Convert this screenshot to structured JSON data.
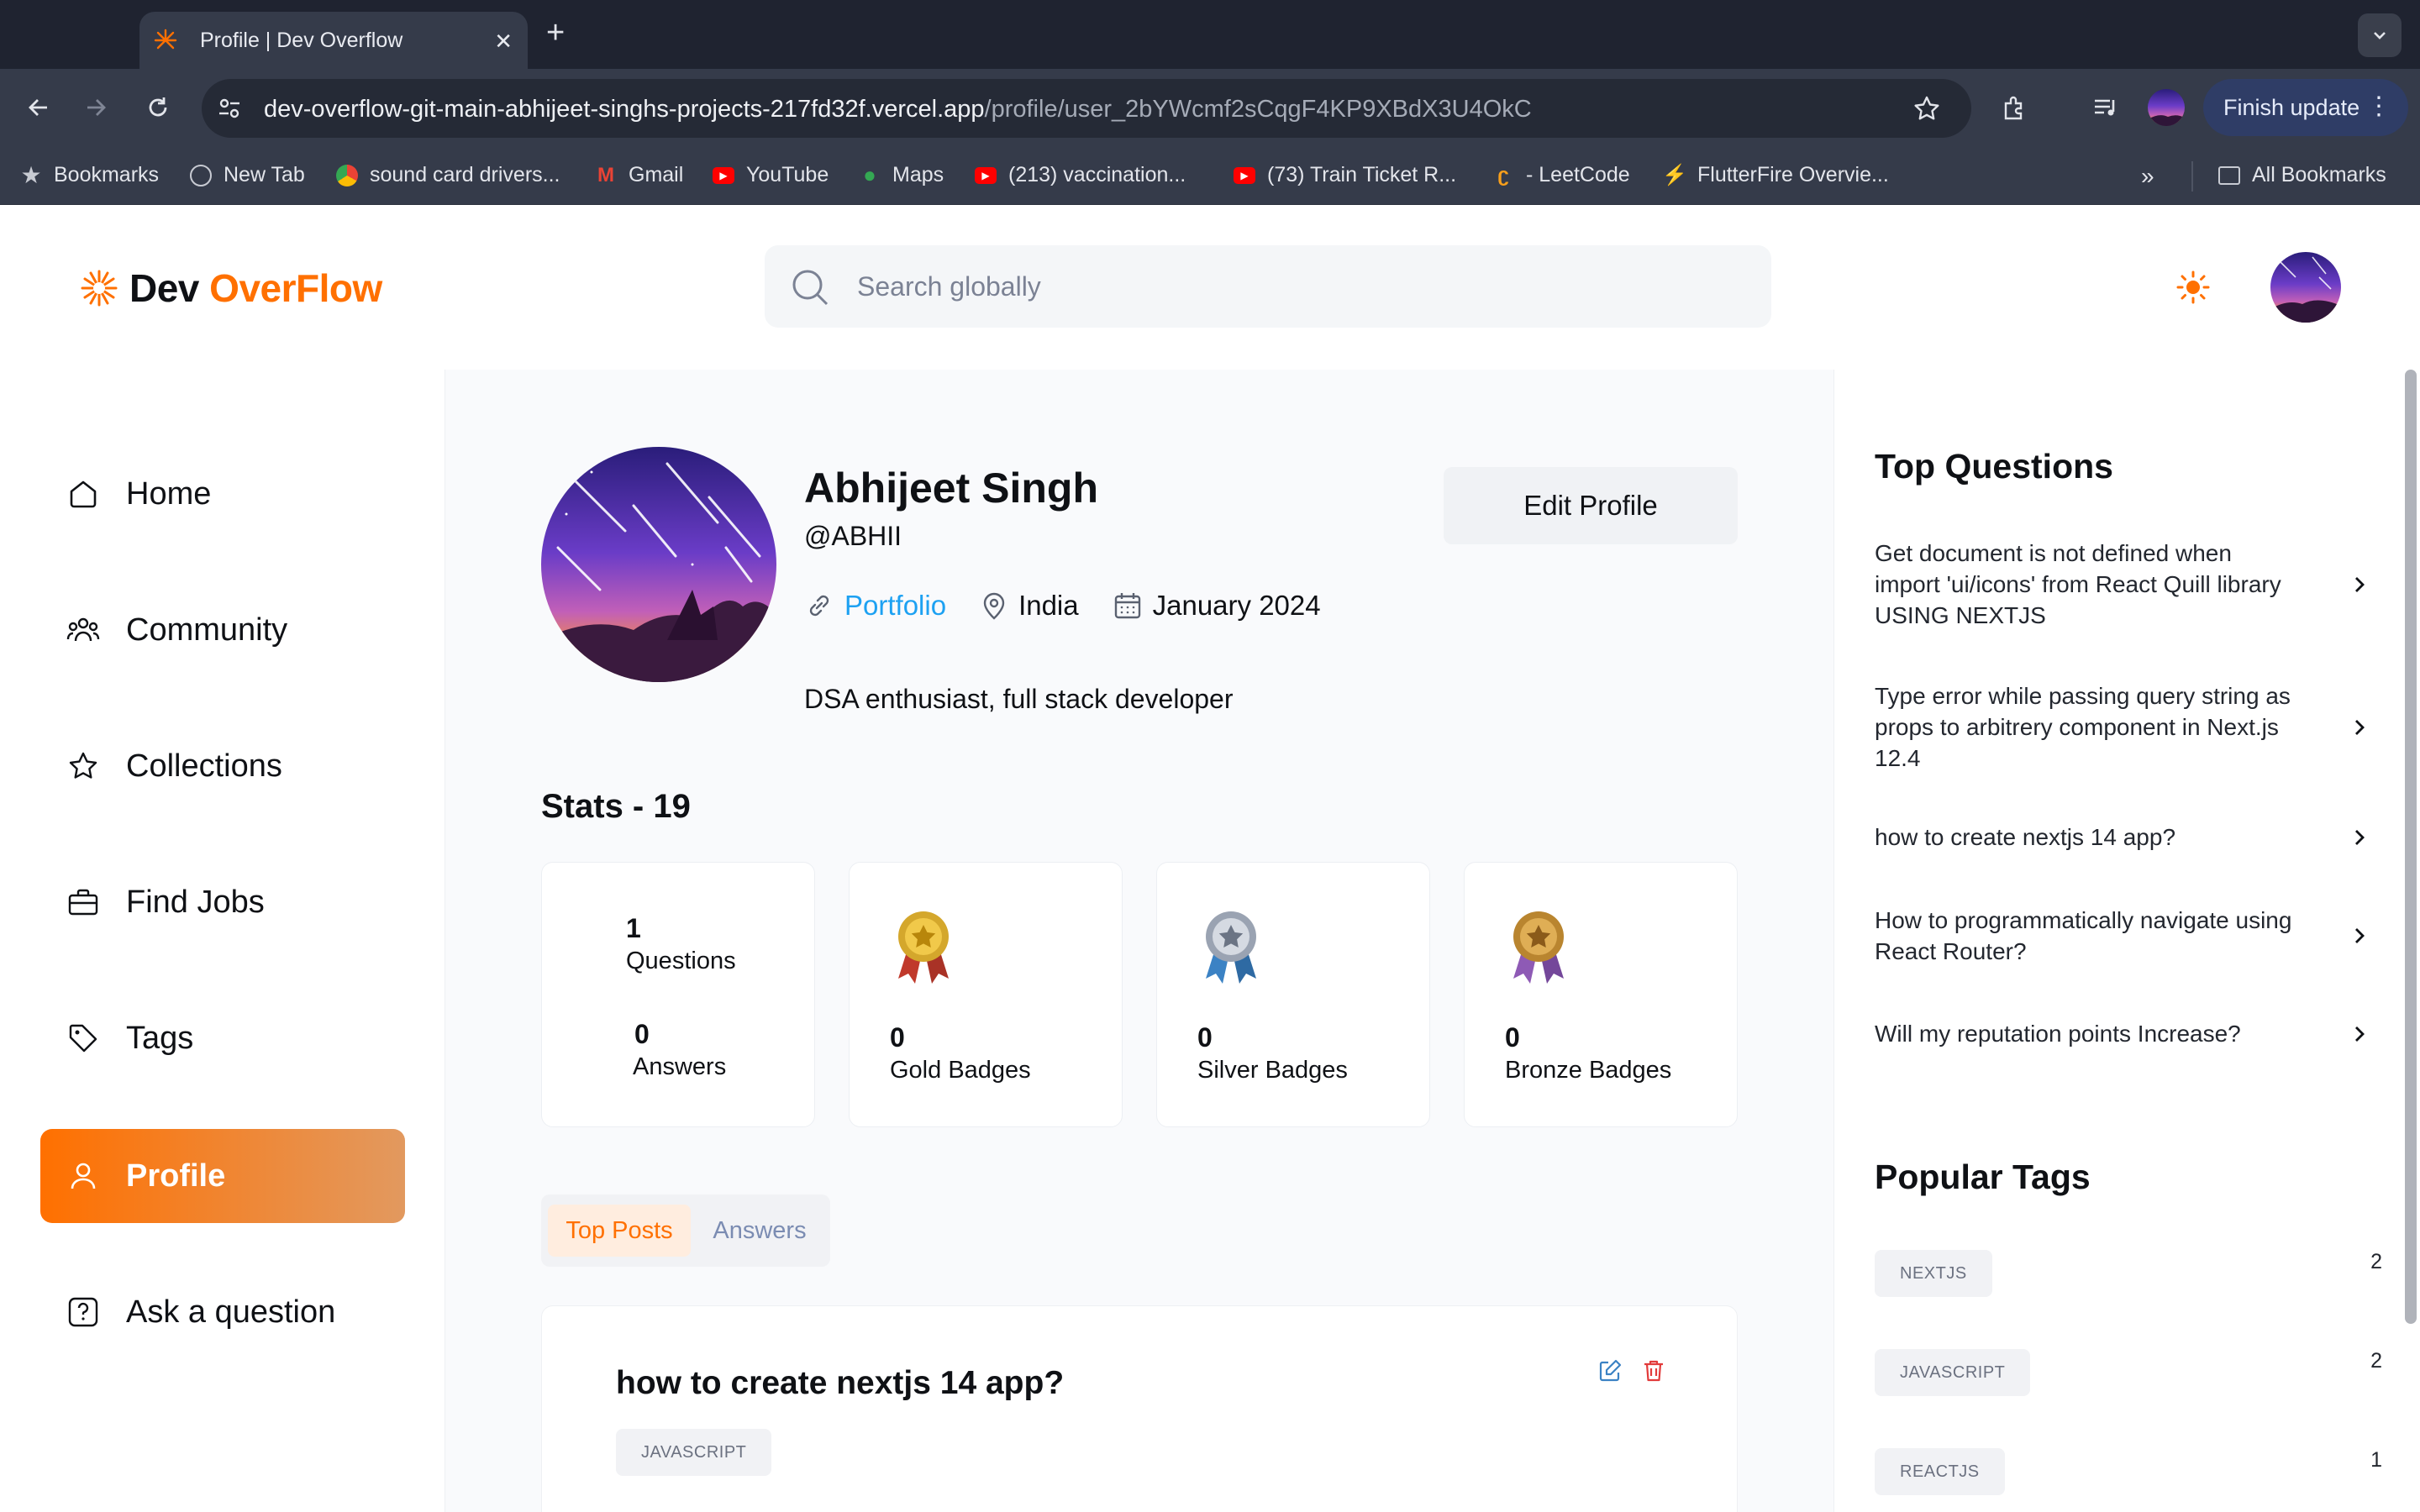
{
  "browser": {
    "tab_title": "Profile | Dev Overflow",
    "url_host": "dev-overflow-git-main-abhijeet-singhs-projects-217fd32f.vercel.app",
    "url_path": "/profile/user_2bYWcmf2sCqgF4KP9XBdX3U4OkC",
    "finish_update": "Finish update",
    "bookmarks": [
      "Bookmarks",
      "New Tab",
      "sound card drivers...",
      "Gmail",
      "YouTube",
      "Maps",
      "(213) vaccination...",
      "(73) Train Ticket R...",
      "- LeetCode",
      "FlutterFire Overvie..."
    ],
    "all_bookmarks": "All Bookmarks"
  },
  "header": {
    "logo_main": "Dev ",
    "logo_accent": "OverFlow",
    "search_placeholder": "Search globally"
  },
  "sidebar": {
    "items": [
      {
        "label": "Home",
        "icon": "home-icon"
      },
      {
        "label": "Community",
        "icon": "users-icon"
      },
      {
        "label": "Collections",
        "icon": "star-icon"
      },
      {
        "label": "Find Jobs",
        "icon": "briefcase-icon"
      },
      {
        "label": "Tags",
        "icon": "tag-icon"
      },
      {
        "label": "Profile",
        "icon": "user-icon",
        "active": true
      },
      {
        "label": "Ask a question",
        "icon": "question-icon"
      }
    ]
  },
  "profile": {
    "name": "Abhijeet Singh",
    "username": "@ABHII",
    "portfolio": "Portfolio",
    "location": "India",
    "joined": "January 2024",
    "bio": "DSA enthusiast, full stack developer",
    "edit_label": "Edit Profile"
  },
  "stats": {
    "title": "Stats - 19",
    "questions": {
      "value": "1",
      "label": "Questions"
    },
    "answers": {
      "value": "0",
      "label": "Answers"
    },
    "badges": [
      {
        "value": "0",
        "label": "Gold Badges",
        "color": "#d4a72c"
      },
      {
        "value": "0",
        "label": "Silver Badges",
        "color": "#8a93a3"
      },
      {
        "value": "0",
        "label": "Bronze Badges",
        "color": "#b9852f"
      }
    ]
  },
  "tabs": {
    "top_posts": "Top Posts",
    "answers": "Answers"
  },
  "post": {
    "title": "how to create nextjs 14 app?",
    "tag": "JAVASCRIPT"
  },
  "right": {
    "top_questions_title": "Top Questions",
    "questions": [
      "Get document is not defined when import 'ui/icons' from React Quill library USING NEXTJS",
      "Type error while passing query string as props to arbitrery component in Next.js 12.4",
      "how to create nextjs 14 app?",
      "How to programmatically navigate using React Router?",
      "Will my reputation points Increase?"
    ],
    "popular_tags_title": "Popular Tags",
    "tags": [
      {
        "name": "NEXTJS",
        "count": "2"
      },
      {
        "name": "JAVASCRIPT",
        "count": "2"
      },
      {
        "name": "REACTJS",
        "count": "1"
      }
    ]
  },
  "colors": {
    "accent": "#ff7000",
    "link": "#1da1f2"
  }
}
